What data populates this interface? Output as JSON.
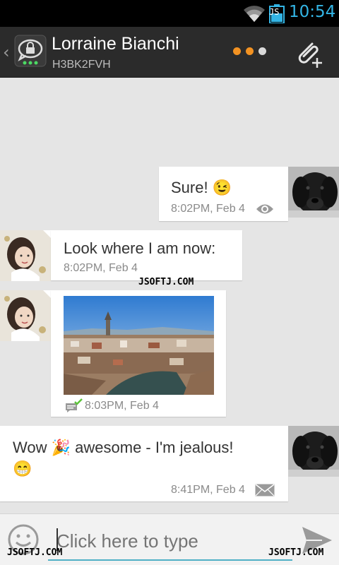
{
  "status_bar": {
    "time": "10:54",
    "battery_label": "JS"
  },
  "header": {
    "contact_name": "Lorraine Bianchi",
    "contact_id": "H3BK2FVH"
  },
  "status_dots": {
    "colors": [
      "#f29222",
      "#f29222",
      "#d9d9d9"
    ]
  },
  "messages": [
    {
      "direction": "outgoing",
      "text": "Sure!",
      "emoji": "😉",
      "time": "8:02PM, Feb 4",
      "status_icon": "eye-icon"
    },
    {
      "direction": "incoming",
      "text": "Look where I am now:",
      "time": "8:02PM, Feb 4"
    },
    {
      "direction": "incoming",
      "type": "image",
      "time": "8:03PM, Feb 4",
      "status_icon": "message-delivered-icon"
    },
    {
      "direction": "outgoing",
      "text_part1": "Wow",
      "emoji1": "🎉",
      "text_part2": "awesome - I'm jealous!",
      "emoji2": "😁",
      "time": "8:41PM, Feb 4",
      "status_icon": "envelope-icon"
    }
  ],
  "input": {
    "placeholder": "Click here to type"
  },
  "watermarks": [
    "JSOFTJ.COM",
    "JSOFTJ.COM",
    "JSOFTJ.COM"
  ],
  "colors": {
    "accent_blue": "#33b5e5",
    "action_bar": "#2b2b2b",
    "chat_bg": "#e5e5e5",
    "input_underline": "#4fb0c6"
  }
}
